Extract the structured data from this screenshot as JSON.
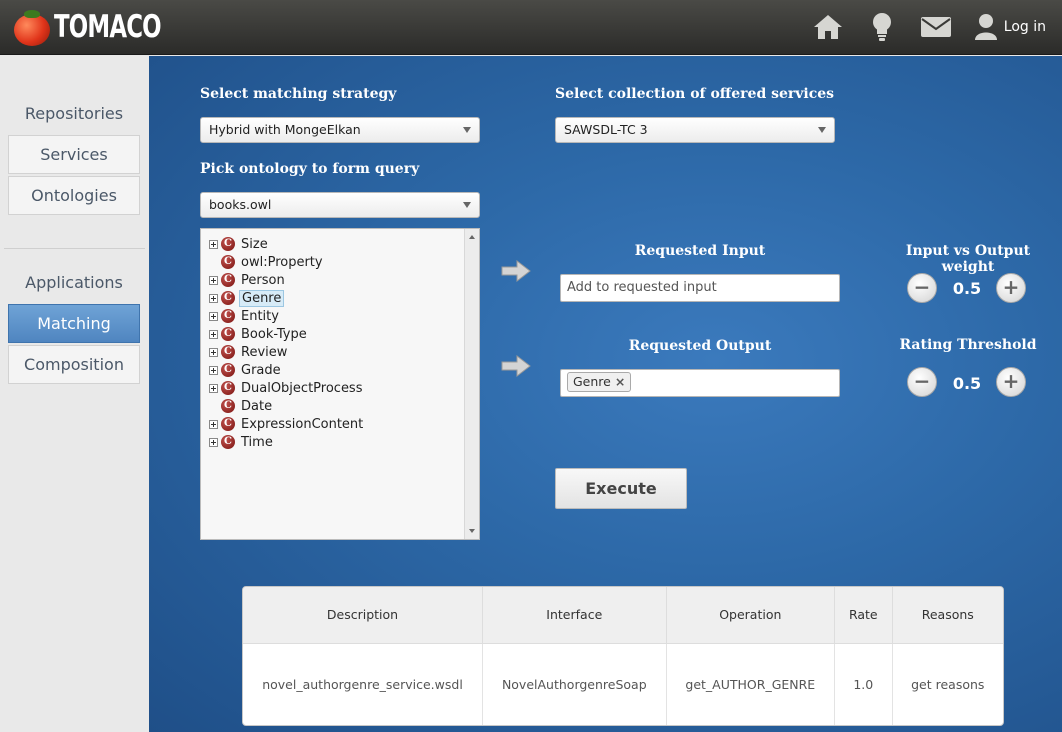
{
  "app": {
    "name": "TOMACO"
  },
  "header": {
    "login_label": "Log in",
    "icons": [
      "home-icon",
      "lightbulb-icon",
      "mail-icon",
      "user-icon"
    ]
  },
  "sidebar": {
    "section1_title": "Repositories",
    "section1_items": [
      {
        "label": "Services"
      },
      {
        "label": "Ontologies"
      }
    ],
    "section2_title": "Applications",
    "section2_items": [
      {
        "label": "Matching",
        "active": true
      },
      {
        "label": "Composition"
      }
    ]
  },
  "form": {
    "strategy_label": "Select matching strategy",
    "strategy_value": "Hybrid with MongeElkan",
    "collection_label": "Select collection of offered services",
    "collection_value": "SAWSDL-TC 3",
    "ontology_label": "Pick ontology to form query",
    "ontology_value": "books.owl"
  },
  "tree": [
    {
      "label": "Size",
      "expandable": true
    },
    {
      "label": "owl:Property",
      "expandable": false
    },
    {
      "label": "Person",
      "expandable": true
    },
    {
      "label": "Genre",
      "expandable": true,
      "selected": true
    },
    {
      "label": "Entity",
      "expandable": true
    },
    {
      "label": "Book-Type",
      "expandable": true
    },
    {
      "label": "Review",
      "expandable": true
    },
    {
      "label": "Grade",
      "expandable": true
    },
    {
      "label": "DualObjectProcess",
      "expandable": true
    },
    {
      "label": "Date",
      "expandable": false
    },
    {
      "label": "ExpressionContent",
      "expandable": true
    },
    {
      "label": "Time",
      "expandable": true
    }
  ],
  "query": {
    "input_label": "Requested Input",
    "input_placeholder": "Add to requested input",
    "output_label": "Requested Output",
    "output_tags": [
      "Genre"
    ],
    "weight_label": "Input vs Output weight",
    "weight_value": "0.5",
    "threshold_label": "Rating Threshold",
    "threshold_value": "0.5",
    "execute_label": "Execute"
  },
  "results": {
    "columns": [
      "Description",
      "Interface",
      "Operation",
      "Rate",
      "Reasons"
    ],
    "rows": [
      [
        "novel_authorgenre_service.wsdl",
        "NovelAuthorgenreSoap",
        "get_AUTHOR_GENRE",
        "1.0",
        "get reasons"
      ]
    ]
  }
}
